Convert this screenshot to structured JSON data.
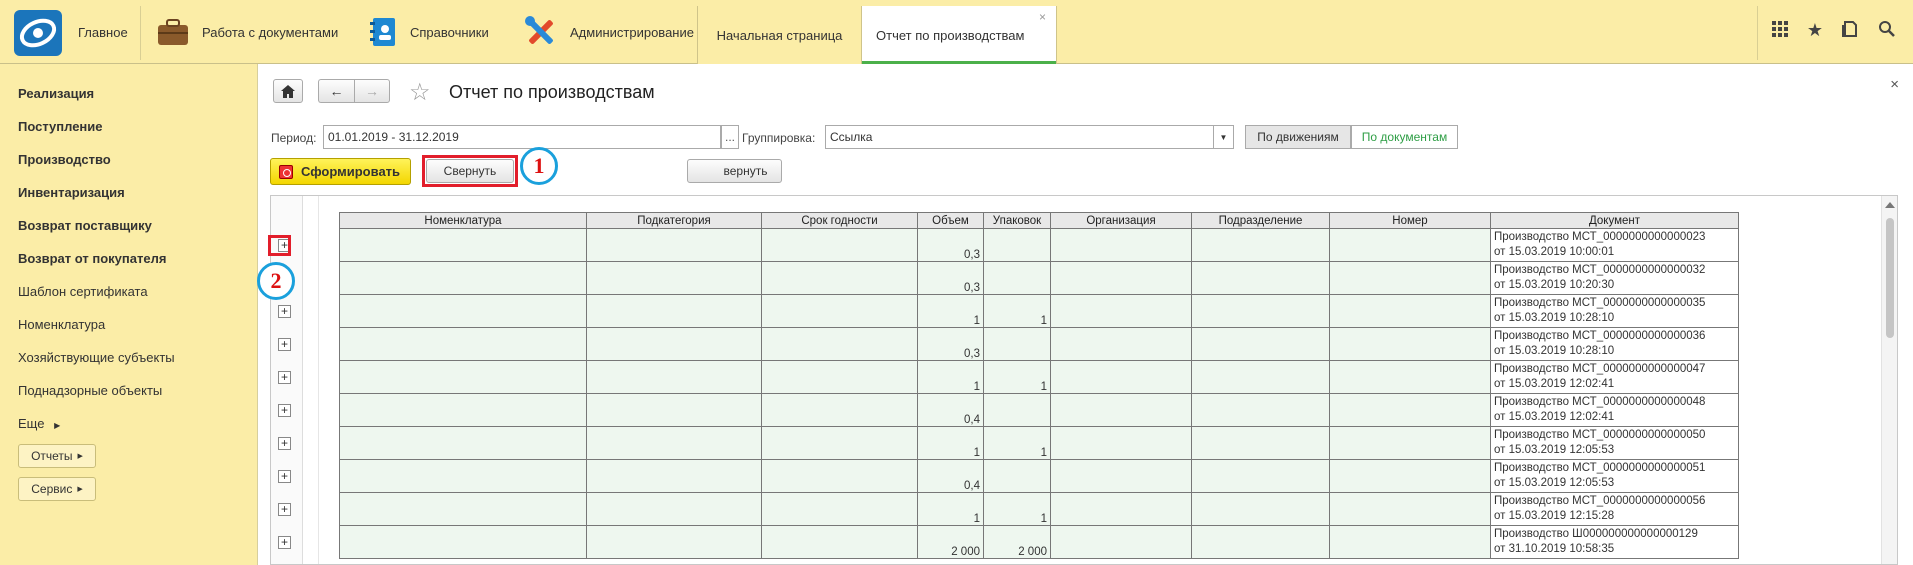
{
  "topnav": {
    "home": "Главное",
    "docs": "Работа с документами",
    "refs": "Справочники",
    "admin": "Администрирование",
    "tab_start": "Начальная страница",
    "tab_report": "Отчет по производствам"
  },
  "sidebar": {
    "items": [
      "Реализация",
      "Поступление",
      "Производство",
      "Инвентаризация",
      "Возврат поставщику",
      "Возврат от покупателя",
      "Шаблон сертификата",
      "Номенклатура",
      "Хозяйствующие субъекты",
      "Поднадзорные объекты",
      "Еще"
    ],
    "reports": "Отчеты",
    "service": "Сервис"
  },
  "form": {
    "title": "Отчет по производствам",
    "period_label": "Период:",
    "period_value": "01.01.2019 - 31.12.2019",
    "group_label": "Группировка:",
    "group_value": "Ссылка",
    "by_moves": "По движениям",
    "by_docs": "По документам",
    "generate": "Сформировать",
    "collapse": "Свернуть",
    "expand": "вернуть"
  },
  "annotations": [
    "1",
    "2"
  ],
  "table": {
    "headers": [
      "Номенклатура",
      "Подкатегория",
      "Срок годности",
      "Объем",
      "Упаковок",
      "Организация",
      "Подразделение",
      "Номер",
      "Документ"
    ],
    "rows": [
      {
        "volume": "0,3",
        "packs": "",
        "doc1": "Производство МСТ_0000000000000023",
        "doc2": "от 15.03.2019 10:00:01"
      },
      {
        "volume": "0,3",
        "packs": "",
        "doc1": "Производство МСТ_0000000000000032",
        "doc2": "от 15.03.2019 10:20:30"
      },
      {
        "volume": "1",
        "packs": "1",
        "doc1": "Производство МСТ_0000000000000035",
        "doc2": "от 15.03.2019 10:28:10"
      },
      {
        "volume": "0,3",
        "packs": "",
        "doc1": "Производство МСТ_0000000000000036",
        "doc2": "от 15.03.2019 10:28:10"
      },
      {
        "volume": "1",
        "packs": "1",
        "doc1": "Производство МСТ_0000000000000047",
        "doc2": "от 15.03.2019 12:02:41"
      },
      {
        "volume": "0,4",
        "packs": "",
        "doc1": "Производство МСТ_0000000000000048",
        "doc2": "от 15.03.2019 12:02:41"
      },
      {
        "volume": "1",
        "packs": "1",
        "doc1": "Производство МСТ_0000000000000050",
        "doc2": "от 15.03.2019 12:05:53"
      },
      {
        "volume": "0,4",
        "packs": "",
        "doc1": "Производство МСТ_0000000000000051",
        "doc2": "от 15.03.2019 12:05:53"
      },
      {
        "volume": "1",
        "packs": "1",
        "doc1": "Производство МСТ_0000000000000056",
        "doc2": "от 15.03.2019 12:15:28"
      },
      {
        "volume": "2 000",
        "packs": "2 000",
        "doc1": "Производство Ш000000000000000129",
        "doc2": "от 31.10.2019 10:58:35"
      }
    ]
  }
}
